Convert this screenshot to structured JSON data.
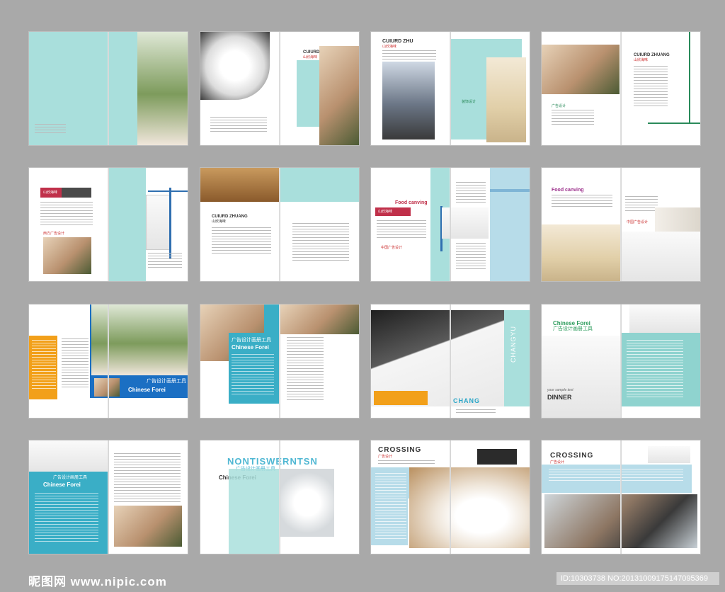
{
  "spreads": [
    {
      "id": "r1c1",
      "title": ""
    },
    {
      "id": "r1c2",
      "title": "CUIURD ZHUAN"
    },
    {
      "id": "r1c3",
      "title": "CUIURD ZHU"
    },
    {
      "id": "r1c4",
      "title": "CUIURD ZHUANG"
    }
  ],
  "labels": {
    "r1c3_cn": "山欣海味",
    "r1c3_cn2": "装饰设计",
    "r1c4_cn": "山欣海味",
    "r1c4_cn2": "广告设计",
    "r1c2_cn": "山欣海味",
    "r2c1_cn": "山欣海味",
    "r2c1_cn2": "西方广告设计",
    "r2c2_title": "CUIURD ZHUANG",
    "r2c2_cn": "山欣海味",
    "r2c3_title": "Food canving",
    "r2c3_cn": "山欣海味",
    "r2c3_cn2": "中国广告设计",
    "r2c4_title": "Food canving",
    "r2c4_cn": "中国广告设计",
    "r3c1_cn": "广告设计画册工具",
    "r3c1_en": "Chinese Forei",
    "r3c2_cn": "广告设计画册工具",
    "r3c2_en": "Chinese Forei",
    "r3c3_en": "CHANG",
    "r3c3_vert": "CHANGYU",
    "r3c4_en": "Chinese Forei",
    "r3c4_cn": "广告设计画册工具",
    "r3c4_script": "your sample text",
    "r3c4_dinner": "DINNER",
    "r4c1_cn": "广告设计画册工具",
    "r4c1_en": "Chinese Forei",
    "r4c2_title": "NONTISWERNTSN",
    "r4c2_cn": "广告设计画册工具",
    "r4c2_en": "Chinese Forei",
    "r4c3_title": "CROSSING",
    "r4c3_cn": "广告设计",
    "r4c4_title": "CROSSING",
    "r4c4_cn": "广告设计"
  },
  "watermark": {
    "site": "昵图网 www.nipic.com",
    "id": "ID:10303738 NO:20131009175147095369"
  }
}
